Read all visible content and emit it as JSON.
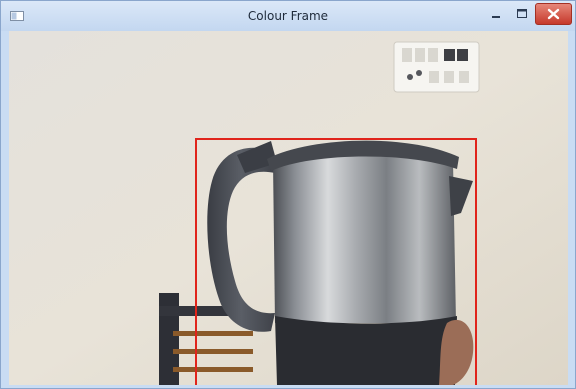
{
  "window": {
    "title": "Colour Frame",
    "controls": [
      "minimize",
      "maximize",
      "close"
    ]
  },
  "frame": {
    "icons": [
      "window-app-icon",
      "minimize-icon",
      "maximize-icon",
      "close-icon"
    ],
    "objects": [
      "kettle",
      "wall-switchboard",
      "chair",
      "hand"
    ],
    "bounding_box_color": "#e0241b",
    "close_button_color": "#c6392b",
    "titlebar_color": "#c9dcf3"
  }
}
